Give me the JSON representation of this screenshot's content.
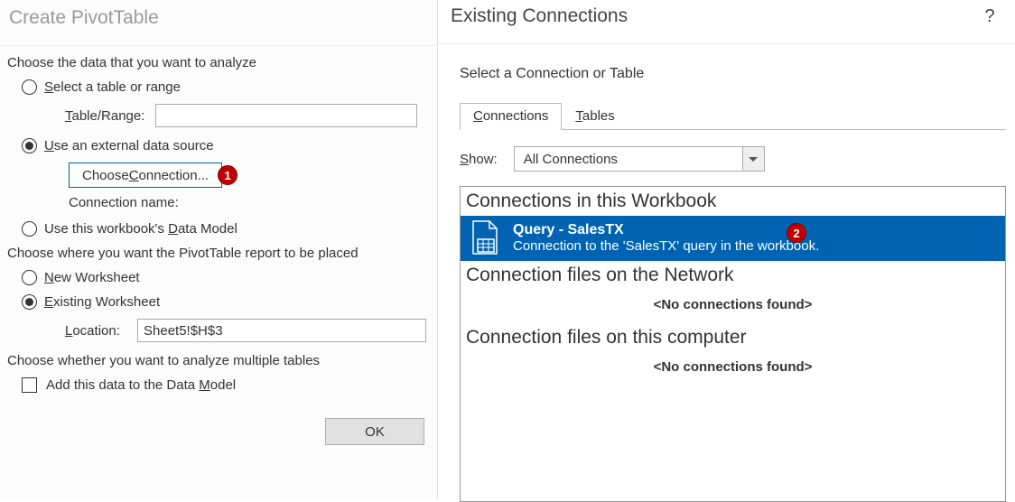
{
  "left": {
    "title": "Create PivotTable",
    "section1": "Choose the data that you want to analyze",
    "opt_select_range": "elect a table or range",
    "opt_select_range_accel": "S",
    "table_range_label": "able/Range:",
    "table_range_accel": "T",
    "opt_external": "se an external data source",
    "opt_external_accel": "U",
    "choose_connection_btn_pre": "Choose ",
    "choose_connection_btn_accel": "C",
    "choose_connection_btn_post": "onnection...",
    "conn_name_label": "Connection name:",
    "opt_datamodel_pre": "Use this workbook's ",
    "opt_datamodel_accel": "D",
    "opt_datamodel_post": "ata Model",
    "section2": "Choose where you want the PivotTable report to be placed",
    "opt_newws_accel": "N",
    "opt_newws": "ew Worksheet",
    "opt_existws_accel": "E",
    "opt_existws": "xisting Worksheet",
    "location_label_accel": "L",
    "location_label": "ocation:",
    "location_value": "Sheet5!$H$3",
    "section3": "Choose whether you want to analyze multiple tables",
    "add_dm_pre": "Add this data to the Data ",
    "add_dm_accel": "M",
    "add_dm_post": "odel",
    "ok": "OK",
    "marker1": "1"
  },
  "right": {
    "title": "Existing Connections",
    "help": "?",
    "subhead": "Select a Connection or Table",
    "tab_conn_accel": "C",
    "tab_conn": "onnections",
    "tab_tables_accel": "T",
    "tab_tables": "ables",
    "show_label_accel": "S",
    "show_label": "how:",
    "show_value": "All Connections",
    "group1": "Connections in this Workbook",
    "item_title": "Query - SalesTX",
    "item_desc": "Connection to the 'SalesTX' query in the workbook.",
    "marker2": "2",
    "group2": "Connection files on the Network",
    "empty": "<No connections found>",
    "group3": "Connection files on this computer"
  }
}
